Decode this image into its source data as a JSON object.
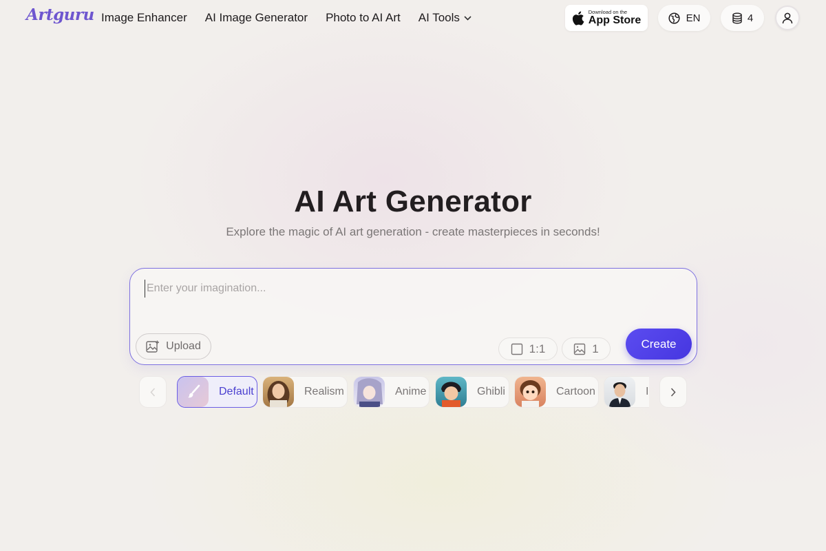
{
  "header": {
    "logo": "Artguru",
    "nav": [
      {
        "label": "Image Enhancer"
      },
      {
        "label": "AI Image Generator"
      },
      {
        "label": "Photo to AI Art"
      },
      {
        "label": "AI Tools"
      }
    ],
    "app_store": {
      "small": "Download on the",
      "big": "App Store"
    },
    "language": "EN",
    "credits": "4"
  },
  "hero": {
    "title": "AI Art Generator",
    "subtitle": "Explore the magic of AI art generation - create masterpieces in seconds!"
  },
  "prompt": {
    "placeholder": "Enter your imagination...",
    "value": "",
    "upload_label": "Upload",
    "ratio": "1:1",
    "count": "1",
    "create_label": "Create"
  },
  "styles": [
    {
      "label": "Default",
      "selected": true
    },
    {
      "label": "Realism",
      "selected": false
    },
    {
      "label": "Anime",
      "selected": false
    },
    {
      "label": "Ghibli",
      "selected": false
    },
    {
      "label": "Cartoon",
      "selected": false
    },
    {
      "label": "I",
      "selected": false
    }
  ],
  "colors": {
    "accent": "#5b4cf0",
    "logo": "#6e56cf"
  }
}
